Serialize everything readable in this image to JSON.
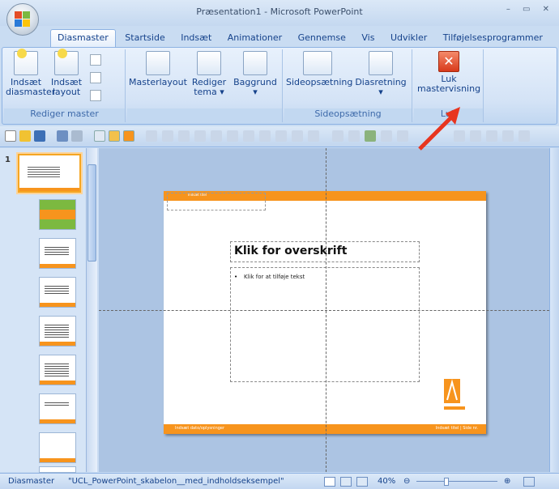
{
  "window": {
    "title": "Præsentation1 - Microsoft PowerPoint",
    "controls": "–  ▭  ✕"
  },
  "tabs": [
    "Diasmaster",
    "Startside",
    "Indsæt",
    "Animationer",
    "Gennemse",
    "Vis",
    "Udvikler",
    "Tilføjelsesprogrammer"
  ],
  "ribbon": {
    "groups": [
      {
        "label": "Rediger master",
        "buttons": [
          {
            "l1": "Indsæt",
            "l2": "diasmaster"
          },
          {
            "l1": "Indsæt",
            "l2": "layout"
          }
        ]
      },
      {
        "label": "",
        "buttons": [
          {
            "l1": "Masterlayout",
            "l2": ""
          },
          {
            "l1": "Rediger",
            "l2": "tema ▾"
          },
          {
            "l1": "Baggrund",
            "l2": "▾"
          }
        ]
      },
      {
        "label": "Sideopsætning",
        "buttons": [
          {
            "l1": "Sideopsætning",
            "l2": ""
          },
          {
            "l1": "Diasretning",
            "l2": "▾"
          }
        ]
      },
      {
        "label": "Luk",
        "buttons": [
          {
            "l1": "Luk",
            "l2": "mastervisning"
          }
        ]
      }
    ]
  },
  "thumbnails": {
    "master_number": "1"
  },
  "slide": {
    "title_placeholder": "Klik for overskrift",
    "body_placeholder": "Klik for at tilføje tekst",
    "footer_left": "Indsæt dato/oplysninger",
    "footer_right": "Indsæt titel  |  Side nr.",
    "top_band_text": "Indsæt titel"
  },
  "status": {
    "view": "Diasmaster",
    "theme": "\"UCL_PowerPoint_skabelon__med_indholdseksempel\"",
    "zoom": "40%"
  },
  "colors": {
    "accent": "#f7941d",
    "ribbon_text": "#15428b",
    "arrow": "#e8351f"
  }
}
